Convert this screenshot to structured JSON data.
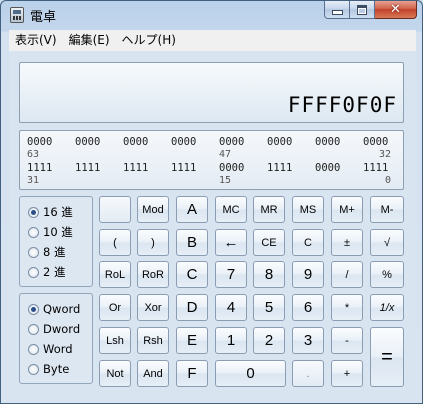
{
  "window": {
    "title": "電卓"
  },
  "caption": {
    "close": "✕"
  },
  "menu": [
    "表示(V)",
    "編集(E)",
    "ヘルプ(H)"
  ],
  "display": {
    "value": "FFFF0F0F"
  },
  "bits": {
    "row1": [
      "0000",
      "0000",
      "0000",
      "0000",
      "0000",
      "0000",
      "0000",
      "0000"
    ],
    "row1_nums": [
      "63",
      "47",
      "32"
    ],
    "row2": [
      "1111",
      "1111",
      "1111",
      "1111",
      "0000",
      "1111",
      "0000",
      "1111"
    ],
    "row2_nums": [
      "31",
      "15",
      "0"
    ]
  },
  "radix": [
    "16 進",
    "10 進",
    "8 進",
    "2 進"
  ],
  "radix_selected": 0,
  "word_size": [
    "Qword",
    "Dword",
    "Word",
    "Byte"
  ],
  "word_selected": 0,
  "keys": {
    "mod": "Mod",
    "A": "A",
    "MC": "MC",
    "MR": "MR",
    "MS": "MS",
    "Mplus": "M+",
    "Mminus": "M-",
    "lparen": "(",
    "rparen": ")",
    "B": "B",
    "backspace": "←",
    "CE": "CE",
    "C": "C",
    "plusminus": "±",
    "sqrt": "√",
    "RoL": "RoL",
    "RoR": "RoR",
    "Ckey": "C",
    "k7": "7",
    "k8": "8",
    "k9": "9",
    "div": "/",
    "pct": "%",
    "Or": "Or",
    "Xor": "Xor",
    "D": "D",
    "k4": "4",
    "k5": "5",
    "k6": "6",
    "mul": "*",
    "recip": "1/x",
    "Lsh": "Lsh",
    "Rsh": "Rsh",
    "E": "E",
    "k1": "1",
    "k2": "2",
    "k3": "3",
    "sub": "-",
    "equals": "=",
    "Not": "Not",
    "And": "And",
    "F": "F",
    "k0": "0",
    "dot": ".",
    "add": "+"
  }
}
